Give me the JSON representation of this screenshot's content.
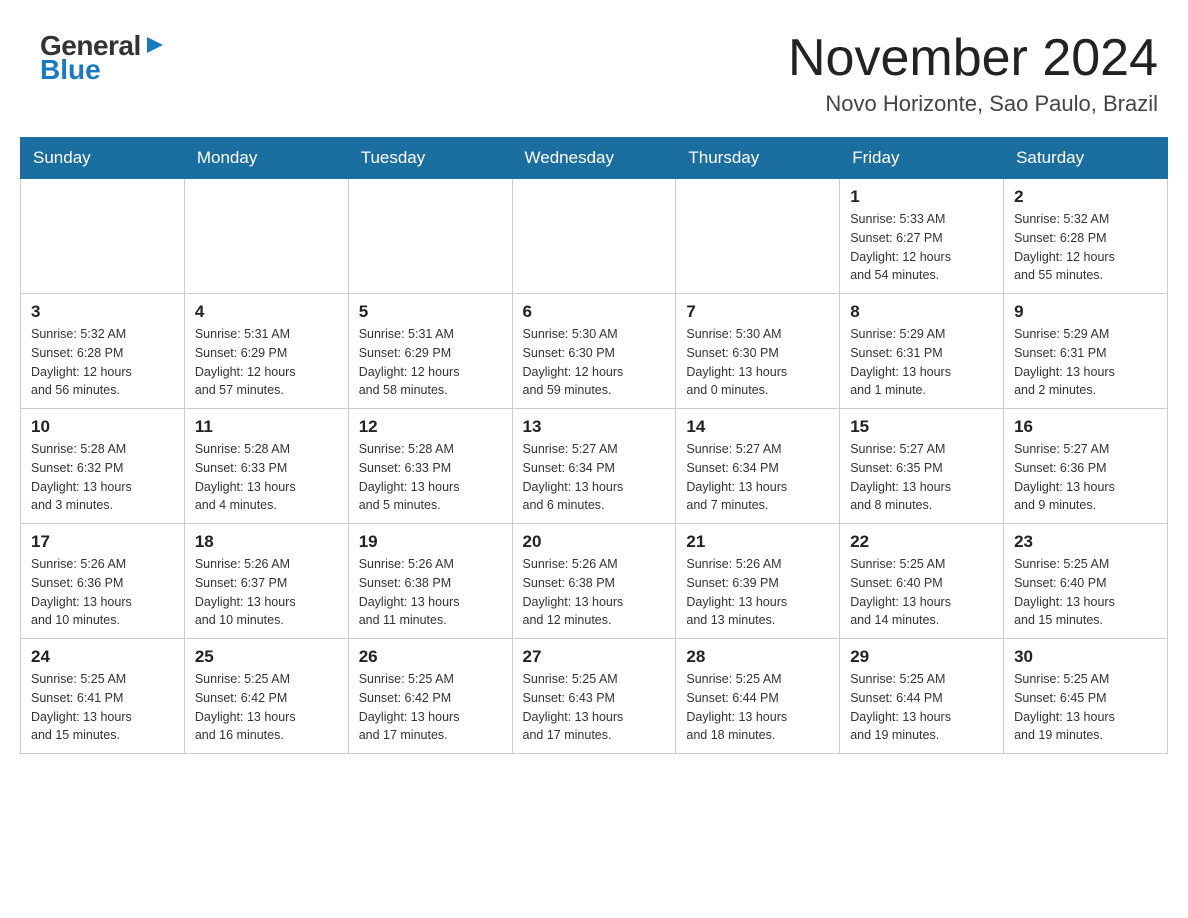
{
  "header": {
    "logo_general": "General",
    "logo_blue": "Blue",
    "month_title": "November 2024",
    "location": "Novo Horizonte, Sao Paulo, Brazil"
  },
  "weekdays": [
    "Sunday",
    "Monday",
    "Tuesday",
    "Wednesday",
    "Thursday",
    "Friday",
    "Saturday"
  ],
  "weeks": [
    [
      {
        "day": "",
        "info": ""
      },
      {
        "day": "",
        "info": ""
      },
      {
        "day": "",
        "info": ""
      },
      {
        "day": "",
        "info": ""
      },
      {
        "day": "",
        "info": ""
      },
      {
        "day": "1",
        "info": "Sunrise: 5:33 AM\nSunset: 6:27 PM\nDaylight: 12 hours\nand 54 minutes."
      },
      {
        "day": "2",
        "info": "Sunrise: 5:32 AM\nSunset: 6:28 PM\nDaylight: 12 hours\nand 55 minutes."
      }
    ],
    [
      {
        "day": "3",
        "info": "Sunrise: 5:32 AM\nSunset: 6:28 PM\nDaylight: 12 hours\nand 56 minutes."
      },
      {
        "day": "4",
        "info": "Sunrise: 5:31 AM\nSunset: 6:29 PM\nDaylight: 12 hours\nand 57 minutes."
      },
      {
        "day": "5",
        "info": "Sunrise: 5:31 AM\nSunset: 6:29 PM\nDaylight: 12 hours\nand 58 minutes."
      },
      {
        "day": "6",
        "info": "Sunrise: 5:30 AM\nSunset: 6:30 PM\nDaylight: 12 hours\nand 59 minutes."
      },
      {
        "day": "7",
        "info": "Sunrise: 5:30 AM\nSunset: 6:30 PM\nDaylight: 13 hours\nand 0 minutes."
      },
      {
        "day": "8",
        "info": "Sunrise: 5:29 AM\nSunset: 6:31 PM\nDaylight: 13 hours\nand 1 minute."
      },
      {
        "day": "9",
        "info": "Sunrise: 5:29 AM\nSunset: 6:31 PM\nDaylight: 13 hours\nand 2 minutes."
      }
    ],
    [
      {
        "day": "10",
        "info": "Sunrise: 5:28 AM\nSunset: 6:32 PM\nDaylight: 13 hours\nand 3 minutes."
      },
      {
        "day": "11",
        "info": "Sunrise: 5:28 AM\nSunset: 6:33 PM\nDaylight: 13 hours\nand 4 minutes."
      },
      {
        "day": "12",
        "info": "Sunrise: 5:28 AM\nSunset: 6:33 PM\nDaylight: 13 hours\nand 5 minutes."
      },
      {
        "day": "13",
        "info": "Sunrise: 5:27 AM\nSunset: 6:34 PM\nDaylight: 13 hours\nand 6 minutes."
      },
      {
        "day": "14",
        "info": "Sunrise: 5:27 AM\nSunset: 6:34 PM\nDaylight: 13 hours\nand 7 minutes."
      },
      {
        "day": "15",
        "info": "Sunrise: 5:27 AM\nSunset: 6:35 PM\nDaylight: 13 hours\nand 8 minutes."
      },
      {
        "day": "16",
        "info": "Sunrise: 5:27 AM\nSunset: 6:36 PM\nDaylight: 13 hours\nand 9 minutes."
      }
    ],
    [
      {
        "day": "17",
        "info": "Sunrise: 5:26 AM\nSunset: 6:36 PM\nDaylight: 13 hours\nand 10 minutes."
      },
      {
        "day": "18",
        "info": "Sunrise: 5:26 AM\nSunset: 6:37 PM\nDaylight: 13 hours\nand 10 minutes."
      },
      {
        "day": "19",
        "info": "Sunrise: 5:26 AM\nSunset: 6:38 PM\nDaylight: 13 hours\nand 11 minutes."
      },
      {
        "day": "20",
        "info": "Sunrise: 5:26 AM\nSunset: 6:38 PM\nDaylight: 13 hours\nand 12 minutes."
      },
      {
        "day": "21",
        "info": "Sunrise: 5:26 AM\nSunset: 6:39 PM\nDaylight: 13 hours\nand 13 minutes."
      },
      {
        "day": "22",
        "info": "Sunrise: 5:25 AM\nSunset: 6:40 PM\nDaylight: 13 hours\nand 14 minutes."
      },
      {
        "day": "23",
        "info": "Sunrise: 5:25 AM\nSunset: 6:40 PM\nDaylight: 13 hours\nand 15 minutes."
      }
    ],
    [
      {
        "day": "24",
        "info": "Sunrise: 5:25 AM\nSunset: 6:41 PM\nDaylight: 13 hours\nand 15 minutes."
      },
      {
        "day": "25",
        "info": "Sunrise: 5:25 AM\nSunset: 6:42 PM\nDaylight: 13 hours\nand 16 minutes."
      },
      {
        "day": "26",
        "info": "Sunrise: 5:25 AM\nSunset: 6:42 PM\nDaylight: 13 hours\nand 17 minutes."
      },
      {
        "day": "27",
        "info": "Sunrise: 5:25 AM\nSunset: 6:43 PM\nDaylight: 13 hours\nand 17 minutes."
      },
      {
        "day": "28",
        "info": "Sunrise: 5:25 AM\nSunset: 6:44 PM\nDaylight: 13 hours\nand 18 minutes."
      },
      {
        "day": "29",
        "info": "Sunrise: 5:25 AM\nSunset: 6:44 PM\nDaylight: 13 hours\nand 19 minutes."
      },
      {
        "day": "30",
        "info": "Sunrise: 5:25 AM\nSunset: 6:45 PM\nDaylight: 13 hours\nand 19 minutes."
      }
    ]
  ],
  "colors": {
    "header_bg": "#1a6fa0",
    "header_text": "#ffffff",
    "accent_blue": "#1a7abf"
  }
}
